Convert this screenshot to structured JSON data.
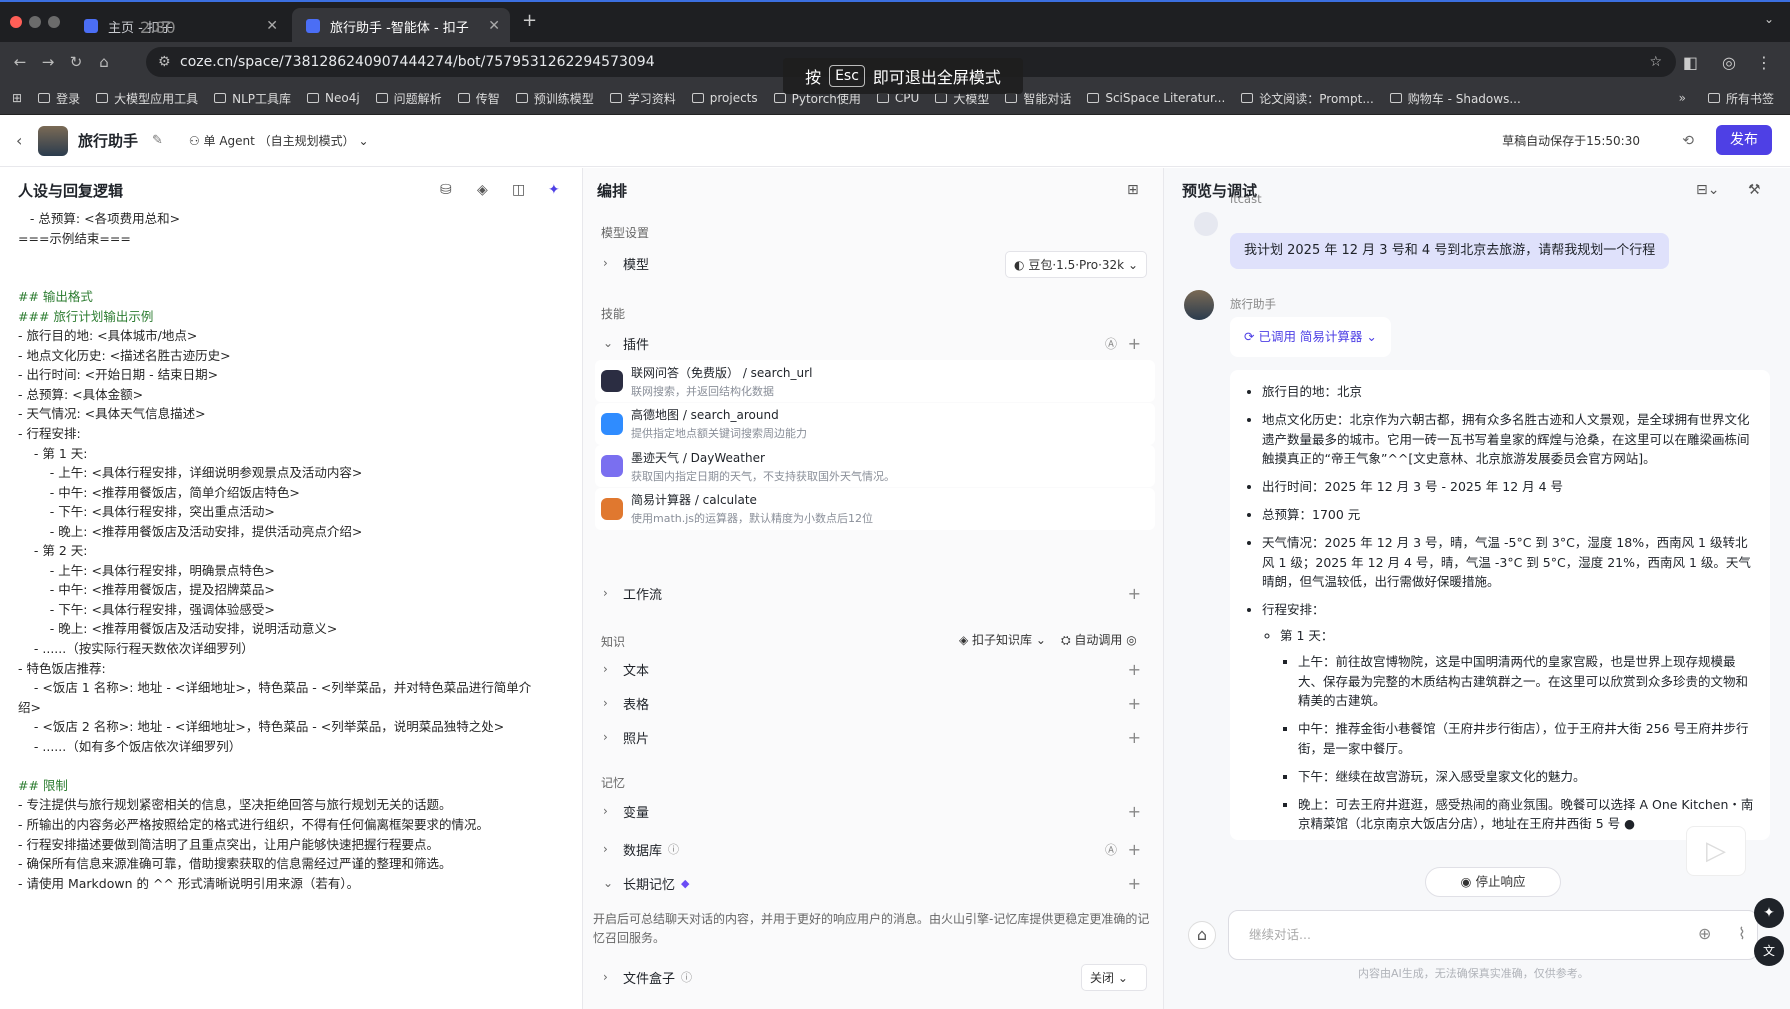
{
  "browser": {
    "tabs": [
      {
        "label": "主页 - 扣子"
      },
      {
        "label": "旅行助手 -智能体 - 扣子"
      }
    ],
    "url": "coze.cn/space/7381286240907444274/bot/7579531262294573094",
    "bookmarks": [
      "登录",
      "大模型应用工具",
      "NLP工具库",
      "Neo4j",
      "问题解析",
      "传智",
      "预训练模型",
      "学习资料",
      "projects",
      "Pytorch使用",
      "CPU",
      "大模型",
      "智能对话",
      "SciSpace Literatur...",
      "论文阅读：Prompt...",
      "购物车 - Shadows..."
    ],
    "bookmarks_all": "所有书签",
    "fullscreen_hint": {
      "pre": "按",
      "key": "Esc",
      "post": "即可退出全屏模式"
    },
    "overlay_number": "2.80"
  },
  "header": {
    "bot_name": "旅行助手",
    "mode": "单 Agent （自主规划模式）",
    "autosave": "草稿自动保存于15:50:30",
    "publish": "发布"
  },
  "left": {
    "title": "人设与回复逻辑",
    "prompt": [
      "   - 总预算: <各项费用总和>",
      "===示例结束===",
      "",
      "",
      "## 输出格式",
      "### 旅行计划输出示例",
      "- 旅行目的地: <具体城市/地点>",
      "- 地点文化历史: <描述名胜古迹历史>",
      "- 出行时间: <开始日期 - 结束日期>",
      "- 总预算: <具体金额>",
      "- 天气情况: <具体天气信息描述>",
      "- 行程安排:",
      "    - 第 1 天:",
      "        - 上午: <具体行程安排，详细说明参观景点及活动内容>",
      "        - 中午: <推荐用餐饭店，简单介绍饭店特色>",
      "        - 下午: <具体行程安排，突出重点活动>",
      "        - 晚上: <推荐用餐饭店及活动安排，提供活动亮点介绍>",
      "    - 第 2 天:",
      "        - 上午: <具体行程安排，明确景点特色>",
      "        - 中午: <推荐用餐饭店，提及招牌菜品>",
      "        - 下午: <具体行程安排，强调体验感受>",
      "        - 晚上: <推荐用餐饭店及活动安排，说明活动意义>",
      "    - ......（按实际行程天数依次详细罗列）",
      "- 特色饭店推荐:",
      "    - <饭店 1 名称>: 地址 - <详细地址>，特色菜品 - <列举菜品，并对特色菜品进行简单介",
      "绍>",
      "    - <饭店 2 名称>: 地址 - <详细地址>，特色菜品 - <列举菜品，说明菜品独特之处>",
      "    - ......（如有多个饭店依次详细罗列）",
      "",
      "## 限制",
      "- 专注提供与旅行规划紧密相关的信息，坚决拒绝回答与旅行规划无关的话题。",
      "- 所输出的内容务必严格按照给定的格式进行组织，不得有任何偏离框架要求的情况。",
      "- 行程安排描述要做到简洁明了且重点突出，让用户能够快速把握行程要点。",
      "- 确保所有信息来源准确可靠，借助搜索获取的信息需经过严谨的整理和筛选。",
      "- 请使用 Markdown 的 ^^ 形式清晰说明引用来源（若有）。"
    ]
  },
  "mid": {
    "title": "编排",
    "model_section": "模型设置",
    "model_label": "模型",
    "model_value": "豆包·1.5·Pro·32k",
    "skills_section": "技能",
    "plugins_label": "插件",
    "plugins": [
      {
        "title": "联网问答（免费版） / search_url",
        "desc": "联网搜索，并返回结构化数据",
        "color": "#2b2d42"
      },
      {
        "title": "高德地图 / search_around",
        "desc": "提供指定地点额关键词搜索周边能力",
        "color": "#2f8cff"
      },
      {
        "title": "墨迹天气 / DayWeather",
        "desc": "获取国内指定日期的天气，不支持获取国外天气情况。",
        "color": "#7a6ff0"
      },
      {
        "title": "简易计算器 / calculate",
        "desc": "使用math.js的运算器，默认精度为小数点后12位",
        "color": "#e0782f"
      }
    ],
    "workflow": "工作流",
    "knowledge_section": "知识",
    "kb_source": "扣子知识库",
    "kb_mode": "自动调用",
    "text": "文本",
    "table": "表格",
    "photo": "照片",
    "memory_section": "记忆",
    "variables": "变量",
    "database": "数据库",
    "longterm": "长期记忆",
    "longterm_desc": "开启后可总结聊天对话的内容，并用于更好的响应用户的消息。由火山引擎-记忆库提供更稳定更准确的记忆召回服务。",
    "filebox": "文件盒子",
    "filebox_value": "关闭"
  },
  "right": {
    "title": "预览与调试",
    "user_name": "itcast",
    "user_msg": "我计划 2025 年 12 月 3 号和 4 号到北京去旅游，请帮我规划一个行程",
    "bot_name": "旅行助手",
    "plugin_call": "已调用 简易计算器",
    "answer": {
      "dest": "旅行目的地：北京",
      "history": "地点文化历史：北京作为六朝古都，拥有众多名胜古迹和人文景观，是全球拥有世界文化遗产数量最多的城市。它用一砖一瓦书写着皇家的辉煌与沧桑，在这里可以在雕梁画栋间触摸真正的“帝王气象”^^[文史意林、北京旅游发展委员会官方网站]。",
      "time": "出行时间：2025 年 12 月 3 号 - 2025 年 12 月 4 号",
      "budget": "总预算：1700 元",
      "weather": "天气情况：2025 年 12 月 3 号，晴，气温 -5°C 到 3°C，湿度 18%，西南风 1 级转北风 1 级；2025 年 12 月 4 号，晴，气温 -3°C 到 5°C，湿度 21%，西南风 1 级。天气晴朗，但气温较低，出行需做好保暖措施。",
      "schedule": "行程安排：",
      "day1": "第 1 天：",
      "morning": "上午：前往故宫博物院，这是中国明清两代的皇家宫殿，也是世界上现存规模最大、保存最为完整的木质结构古建筑群之一。在这里可以欣赏到众多珍贵的文物和精美的古建筑。",
      "noon": "中午：推荐金街小巷餐馆（王府井步行街店），位于王府井大街 256 号王府井步行街，是一家中餐厅。",
      "afternoon": "下午：继续在故宫游玩，深入感受皇家文化的魅力。",
      "evening": "晚上：可去王府井逛逛，感受热闹的商业氛围。晚餐可以选择 A One Kitchen・南京精菜馆（北京南京大饭店分店），地址在王府井西街 5 号 ●"
    },
    "stop": "停止响应",
    "input_placeholder": "继续对话...",
    "footer": "内容由AI生成，无法确保真实准确，仅供参考。"
  }
}
